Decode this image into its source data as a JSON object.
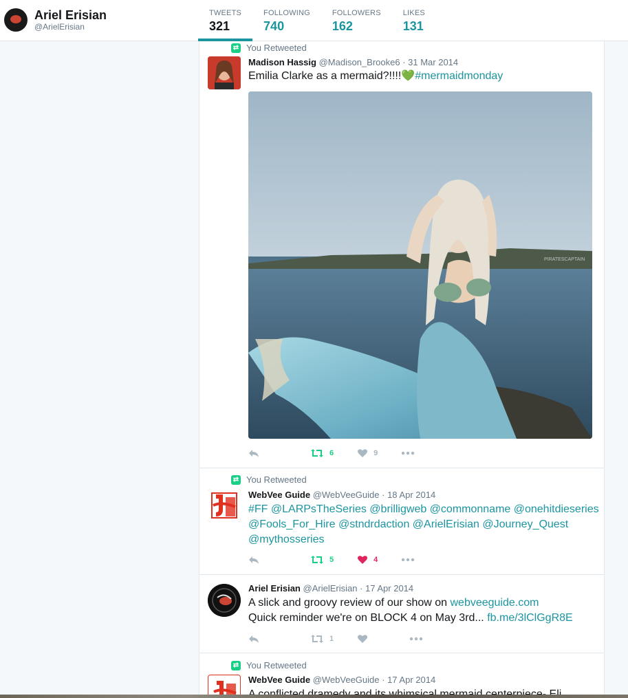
{
  "profile": {
    "name": "Ariel Erisian",
    "handle": "@ArielErisian"
  },
  "stats": [
    {
      "label": "TWEETS",
      "value": "321"
    },
    {
      "label": "FOLLOWING",
      "value": "740"
    },
    {
      "label": "FOLLOWERS",
      "value": "162"
    },
    {
      "label": "LIKES",
      "value": "131"
    }
  ],
  "tweets": [
    {
      "retweet_label": "You Retweeted",
      "name": "Madison Hassig",
      "handle": "@Madison_Brooke6",
      "date": "· 31 Mar 2014",
      "text": "Emilia Clarke as a mermaid?!!!!",
      "emoji": "💚",
      "hashtag": "#mermaidmonday",
      "media_watermark": "PIRATESCAPTAIN",
      "retweets": "6",
      "likes": "9"
    },
    {
      "retweet_label": "You Retweeted",
      "name": "WebVee Guide",
      "handle": "@WebVeeGuide",
      "date": "· 18 Apr 2014",
      "line1": "#FF @LARPsTheSeries @brilligweb @commonname @onehitdieseries",
      "line2": "@Fools_For_Hire @stndrdaction @ArielErisian @Journey_Quest",
      "line3": "@mythosseries",
      "retweets": "5",
      "likes": "4"
    },
    {
      "name": "Ariel Erisian",
      "handle": "@ArielErisian",
      "date": "· 17 Apr 2014",
      "line1_text": "A slick and groovy review of our show on ",
      "line1_link": "webveeguide.com",
      "line2_text": "Quick reminder we're on BLOCK 4 on May 3rd... ",
      "line2_link": "fb.me/3lClGgR8E",
      "retweets": "1"
    },
    {
      "retweet_label": "You Retweeted",
      "name": "WebVee Guide",
      "handle": "@WebVeeGuide",
      "date": "· 17 Apr 2014",
      "text": "A conflicted dramedy and its whimsical mermaid centerpiece- Eli"
    }
  ],
  "icons": {
    "reply": "reply-icon",
    "retweet": "retweet-icon",
    "like": "heart-icon",
    "more": "more-icon"
  },
  "colors": {
    "accent": "#1b95a0",
    "retweet_green": "#19cf86",
    "like_red": "#e0245e",
    "muted": "#aab8c2"
  }
}
